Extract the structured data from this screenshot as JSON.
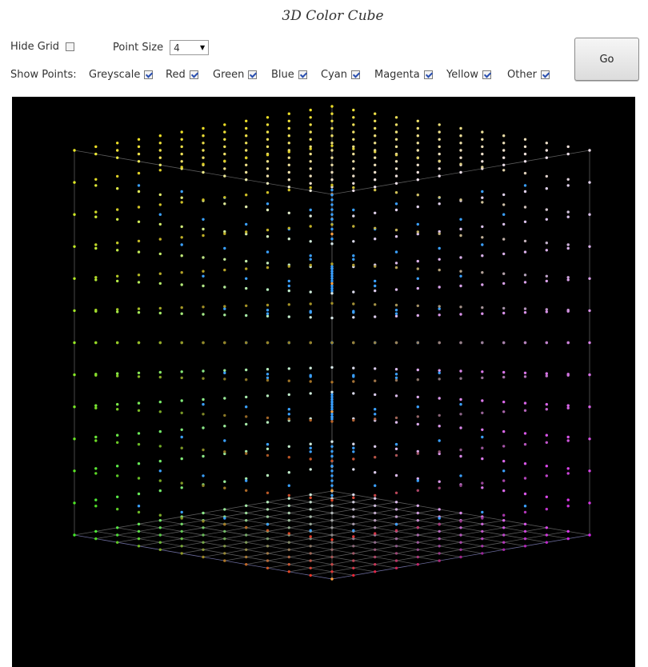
{
  "title": "3D Color Cube",
  "controls": {
    "hide_grid_label": "Hide Grid",
    "hide_grid_checked": false,
    "point_size_label": "Point Size",
    "point_size_value": "4",
    "show_points_label": "Show Points:",
    "show_points": [
      {
        "label": "Greyscale",
        "checked": true
      },
      {
        "label": "Red",
        "checked": true
      },
      {
        "label": "Green",
        "checked": true
      },
      {
        "label": "Blue",
        "checked": true
      },
      {
        "label": "Cyan",
        "checked": true
      },
      {
        "label": "Magenta",
        "checked": true
      },
      {
        "label": "Yellow",
        "checked": true
      },
      {
        "label": "Other",
        "checked": true
      }
    ],
    "go_label": "Go"
  },
  "scene": {
    "background": "#000000",
    "grid_color": "#5a5a5a",
    "colors": {
      "greyscale": "#ffa040",
      "cyan_axis": "#3aa0ff"
    }
  }
}
